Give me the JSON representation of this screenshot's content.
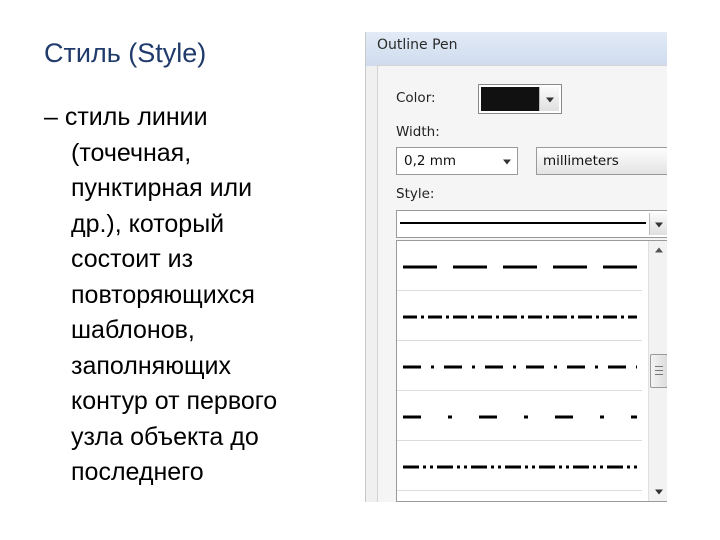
{
  "slide": {
    "title": "Стиль (Style)",
    "bullet_lines": [
      "– стиль линии",
      "(точечная,",
      "пунктирная или",
      "др.), который",
      "состоит из",
      "повторяющихся",
      "шаблонов,",
      "заполняющих",
      "контур от первого",
      "узла объекта до",
      "последнего"
    ]
  },
  "dialog": {
    "title": "Outline Pen",
    "color_label": "Color:",
    "color_value": "#111111",
    "width_label": "Width:",
    "width_value": "0,2 mm",
    "units_value": "millimeters",
    "style_label": "Style:",
    "style_options": [
      "long-dash",
      "dash-dot-fine",
      "dash-dot",
      "dash-dot-sparse",
      "dash-dot-dot-fine"
    ]
  }
}
